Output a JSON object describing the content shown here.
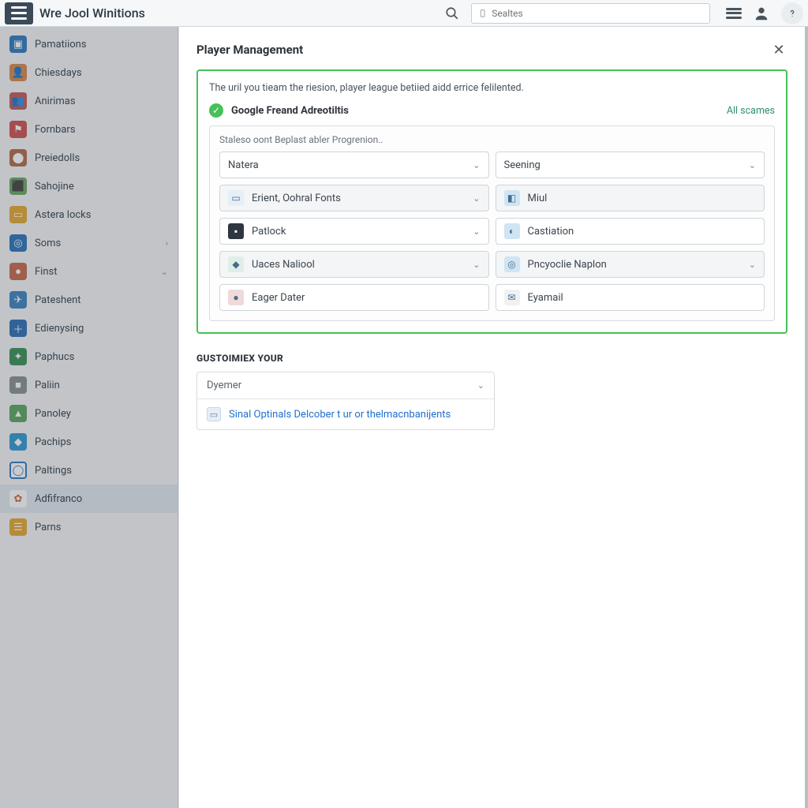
{
  "header": {
    "app_title": "Wre Jool Winitions",
    "search_placeholder": "Sealtes"
  },
  "sidebar": {
    "items": [
      {
        "label": "Pamatiions",
        "icon_bg": "#2f7bbf",
        "icon_glyph": "▣"
      },
      {
        "label": "Chiesdays",
        "icon_bg": "#d68a4a",
        "icon_glyph": "👤"
      },
      {
        "label": "Anirimas",
        "icon_bg": "#c15a5a",
        "icon_glyph": "👥"
      },
      {
        "label": "Fornbars",
        "icon_bg": "#d04f4f",
        "icon_glyph": "⚑"
      },
      {
        "label": "Preiedolls",
        "icon_bg": "#b06b49",
        "icon_glyph": "⬤"
      },
      {
        "label": "Sahojine",
        "icon_bg": "#6aa862",
        "icon_glyph": "⬛"
      },
      {
        "label": "Astera locks",
        "icon_bg": "#e3a830",
        "icon_glyph": "▭"
      },
      {
        "label": "Soms",
        "icon_bg": "#2b73b8",
        "icon_glyph": "◎",
        "chevron": "›"
      },
      {
        "label": "Finst",
        "icon_bg": "#c76a4a",
        "icon_glyph": "●",
        "chevron": "⌄"
      },
      {
        "label": "Pateshent",
        "icon_bg": "#3e84c0",
        "icon_glyph": "✈"
      },
      {
        "label": "Edienysing",
        "icon_bg": "#2d6fb4",
        "icon_glyph": "＋"
      },
      {
        "label": "Paphucs",
        "icon_bg": "#3a8f55",
        "icon_glyph": "✦"
      },
      {
        "label": "Paliin",
        "icon_bg": "#8a908f",
        "icon_glyph": "■"
      },
      {
        "label": "Panoley",
        "icon_bg": "#5aa65e",
        "icon_glyph": "▲"
      },
      {
        "label": "Pachips",
        "icon_bg": "#2f9ad1",
        "icon_glyph": "◆"
      },
      {
        "label": "Paltings",
        "icon_bg": "#ffffff",
        "icon_glyph": "◯",
        "icon_fg": "#2f7bbf",
        "border": "#2f7bbf"
      },
      {
        "label": "Adfifranco",
        "icon_bg": "#ffffff",
        "icon_glyph": "✿",
        "icon_fg": "#c9693a",
        "active": true
      },
      {
        "label": "Parns",
        "icon_bg": "#e3a830",
        "icon_glyph": "☰"
      }
    ]
  },
  "modal": {
    "title": "Player Management",
    "description": "The uril you tieam the riesion, player league betiied aidd errice felilented.",
    "status": {
      "label": "Google Freand Adreotiltis",
      "link": "All scames"
    },
    "inner_hint": "Staleso oont Beplast abler Progrenion..",
    "left_fields": [
      {
        "label": "Natera",
        "chevron": true
      },
      {
        "label": "Erient, Oohral Fonts",
        "chevron": true,
        "badge_bg": "#e6eef6",
        "badge_glyph": "▭",
        "alt": true
      },
      {
        "label": "Patlock",
        "chevron": true,
        "badge_bg": "#2e3640",
        "badge_glyph": "▪",
        "badge_fg": "#fff"
      },
      {
        "label": "Uaces Naliool",
        "chevron": true,
        "badge_bg": "#dfeee6",
        "badge_glyph": "◆",
        "alt": true
      },
      {
        "label": "Eager Dater",
        "badge_bg": "#efd9d9",
        "badge_glyph": "●"
      }
    ],
    "right_fields": [
      {
        "label": "Seening",
        "chevron": true
      },
      {
        "label": "Miul",
        "badge_bg": "#cfe5f4",
        "badge_glyph": "◧",
        "alt": true
      },
      {
        "label": "Castiation",
        "badge_bg": "#cfe5f4",
        "badge_glyph": "◐"
      },
      {
        "label": "Pncyoclie Naplon",
        "chevron": true,
        "badge_bg": "#cfe5f4",
        "badge_glyph": "◎",
        "alt": true
      },
      {
        "label": "Eyamail",
        "badge_bg": "#eef2f4",
        "badge_glyph": "✉"
      }
    ],
    "custom": {
      "title": "Gustoimiex Your",
      "select_label": "Dyemer",
      "option_label": "Sinal Optinals Delcober t ur or thelmacnbanijents"
    }
  }
}
